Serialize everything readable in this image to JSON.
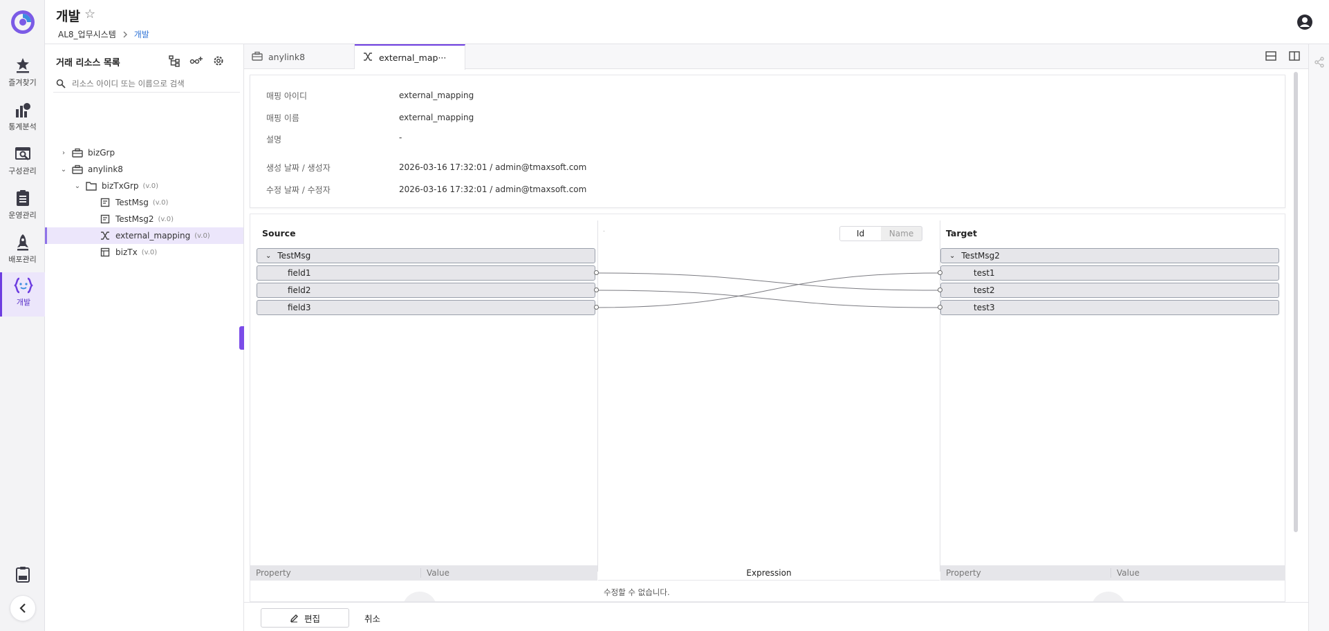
{
  "header": {
    "title": "개발",
    "breadcrumb": [
      "AL8_업무시스템",
      "개발"
    ]
  },
  "nav": {
    "items": [
      {
        "label": "즐겨찾기",
        "icon": "favorites-icon"
      },
      {
        "label": "통계분석",
        "icon": "statistics-icon"
      },
      {
        "label": "구성관리",
        "icon": "configuration-icon"
      },
      {
        "label": "운영관리",
        "icon": "operations-icon"
      },
      {
        "label": "배포관리",
        "icon": "deploy-rocket-icon"
      },
      {
        "label": "개발",
        "icon": "code-braces-icon"
      }
    ],
    "active": "개발"
  },
  "sidebar": {
    "title": "거래 리소스 목록",
    "search_placeholder": "리소스 아이디 또는 이름으로 검색",
    "tree": [
      {
        "label": "bizGrp",
        "version": ""
      },
      {
        "label": "anylink8",
        "version": ""
      },
      {
        "label": "bizTxGrp",
        "version": "(v.0)"
      },
      {
        "label": "TestMsg",
        "version": "(v.0)"
      },
      {
        "label": "TestMsg2",
        "version": "(v.0)"
      },
      {
        "label": "external_mapping",
        "version": "(v.0)"
      },
      {
        "label": "bizTx",
        "version": "(v.0)"
      }
    ]
  },
  "tabs": [
    {
      "label": "anylink8"
    },
    {
      "label": "external_map···"
    }
  ],
  "info": {
    "rows": [
      {
        "label": "매핑 아이디",
        "value": "external_mapping"
      },
      {
        "label": "매핑 이름",
        "value": "external_mapping"
      },
      {
        "label": "설명",
        "value": "-"
      },
      {
        "label": "생성 날짜 / 생성자",
        "value": "2026-03-16 17:32:01 / admin@tmaxsoft.com"
      },
      {
        "label": "수정 날짜 / 수정자",
        "value": "2026-03-16 17:32:01 / admin@tmaxsoft.com"
      }
    ]
  },
  "mapping": {
    "source_title": "Source",
    "target_title": "Target",
    "middle_dot": ".",
    "toggle": {
      "id": "Id",
      "name": "Name",
      "selected": "Id"
    },
    "source": {
      "message": "TestMsg",
      "fields": [
        "field1",
        "field2",
        "field3"
      ]
    },
    "target": {
      "message": "TestMsg2",
      "fields": [
        "test1",
        "test2",
        "test3"
      ]
    },
    "links": [
      {
        "from": "field1",
        "to": "test2"
      },
      {
        "from": "field2",
        "to": "test3"
      },
      {
        "from": "field3",
        "to": "test1"
      }
    ],
    "left_panel": {
      "property": "Property",
      "value": "Value"
    },
    "expression": {
      "title": "Expression",
      "note": "수정할 수 없습니다."
    },
    "right_panel": {
      "property": "Property",
      "value": "Value"
    }
  },
  "footer": {
    "edit_label": "편집",
    "cancel_label": "취소"
  },
  "colors": {
    "accent": "#6d3de0",
    "selected_bg": "#ece6fb",
    "link_blue": "#2f73d6"
  }
}
